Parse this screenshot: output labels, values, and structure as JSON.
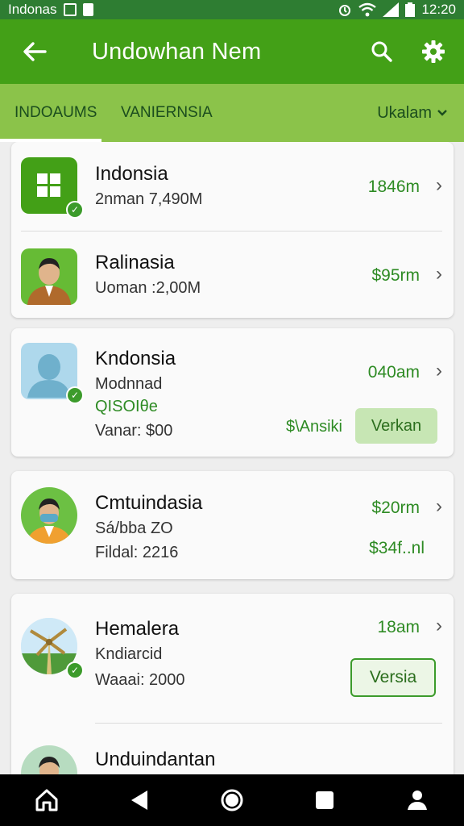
{
  "status_bar": {
    "carrier": "Indonas",
    "time": "12:20"
  },
  "app_bar": {
    "title": "Undowhan Nem",
    "back_icon": "arrow-left-icon",
    "search_icon": "search-icon",
    "settings_icon": "gear-icon"
  },
  "tabs": {
    "tab1": "INDOAUMS",
    "tab2": "VANIERNSIA",
    "dropdown": "Ukalam"
  },
  "cards": [
    {
      "rows": [
        {
          "name": "Indonsia",
          "sub": "2nman 7,490M",
          "amount": "1846m"
        },
        {
          "name": "Ralinasia",
          "sub": "Uoman :2,00M",
          "amount": "$95rm"
        }
      ]
    },
    {
      "name": "Kndonsia",
      "sub1": "Modnnad",
      "sub2": "QISOIθe",
      "sub3": "Vanar: $00",
      "amount": "040am",
      "extra": "$\\Ansiki",
      "button": "Verkan"
    },
    {
      "name": "Cmtuindasia",
      "sub1": "Sá/bba ZO",
      "sub2": "Fildal: 2216",
      "amount": "$20rm",
      "amount2": "$34f..nl"
    },
    {
      "name": "Hemalera",
      "sub1": "Kndiarcid",
      "sub2": "Waaai: 2000",
      "amount": "18am",
      "button": "Versia"
    },
    {
      "name": "Unduindantan"
    }
  ],
  "colors": {
    "primary": "#43a017",
    "tabs": "#8bc34a",
    "accent_text": "#2e8b24",
    "status": "#2e7d32"
  }
}
